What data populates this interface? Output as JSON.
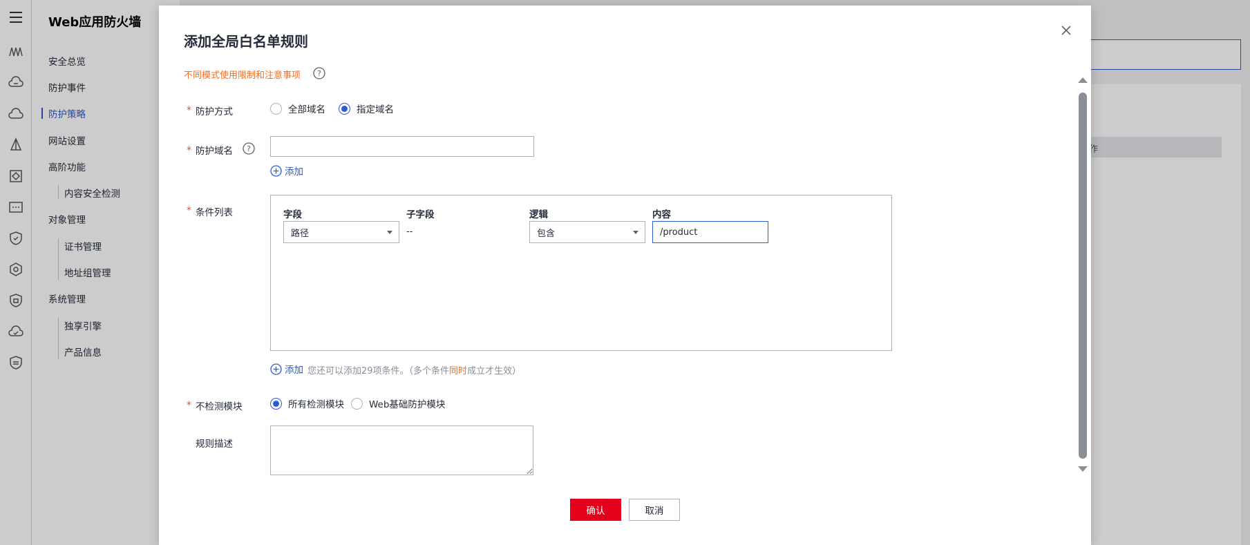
{
  "app": {
    "title": "Web应用防火墙",
    "nav": {
      "overview": "安全总览",
      "events": "防护事件",
      "policy": "防护策略",
      "website": "网站设置",
      "advanced": "高阶功能",
      "content_check": "内容安全检测",
      "objects": "对象管理",
      "certs": "证书管理",
      "addr_groups": "地址组管理",
      "system": "系统管理",
      "engine": "独享引擎",
      "product": "产品信息"
    },
    "bg_table_header_partial": "作"
  },
  "modal": {
    "title": "添加全局白名单规则",
    "notice_link": "不同模式使用限制和注意事项",
    "required_mark": "*",
    "protect_mode": {
      "label": "防护方式",
      "options": [
        "全部域名",
        "指定域名"
      ],
      "selected": "指定域名"
    },
    "protect_domain": {
      "label": "防护域名",
      "value": "",
      "add_label": "添加"
    },
    "conditions": {
      "label": "条件列表",
      "columns": [
        "字段",
        "子字段",
        "逻辑",
        "内容"
      ],
      "row": {
        "field": "路径",
        "subfield": "--",
        "logic": "包含",
        "content": "/product"
      },
      "add_label": "添加",
      "hint_before": "您还可以添加29项条件。（多个条件",
      "hint_highlight": "同时",
      "hint_after": "成立才生效）"
    },
    "skip_module": {
      "label": "不检测模块",
      "options": [
        "所有检测模块",
        "Web基础防护模块"
      ],
      "selected": "所有检测模块"
    },
    "description": {
      "label": "规则描述",
      "value": ""
    },
    "confirm_label": "确认",
    "cancel_label": "取消"
  },
  "colors": {
    "primary": "#2c5bd1",
    "danger": "#e3001b",
    "warning": "#fa6b18"
  }
}
